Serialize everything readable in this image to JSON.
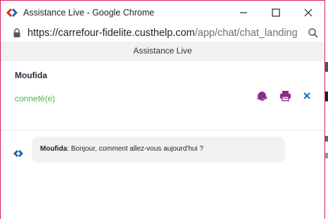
{
  "browser": {
    "window_title": "Assistance Live - Google Chrome",
    "url_host": "https://carrefour-fidelite.custhelp.com",
    "url_path": "/app/chat/chat_landing"
  },
  "chat": {
    "header_title": "Assistance Live",
    "agent_name": "Moufida",
    "agent_status": "conneté(e)",
    "messages": [
      {
        "sender": "Moufida",
        "separator": ": ",
        "text": "Bonjour, comment allez-vous aujourd'hui ?"
      }
    ]
  },
  "colors": {
    "accent_purple": "#8e2b8a",
    "close_blue": "#1a6fb5",
    "status_green": "#4caf50",
    "frame_pink": "#d81b60"
  },
  "icons": {
    "favicon": "carrefour-logo-icon",
    "lock": "lock-icon",
    "zoom": "zoom-icon",
    "sound": "sound-icon",
    "print": "print-icon",
    "close_chat": "close-icon",
    "minimize": "minimize-icon",
    "maximize": "maximize-icon",
    "close_window": "close-window-icon"
  }
}
